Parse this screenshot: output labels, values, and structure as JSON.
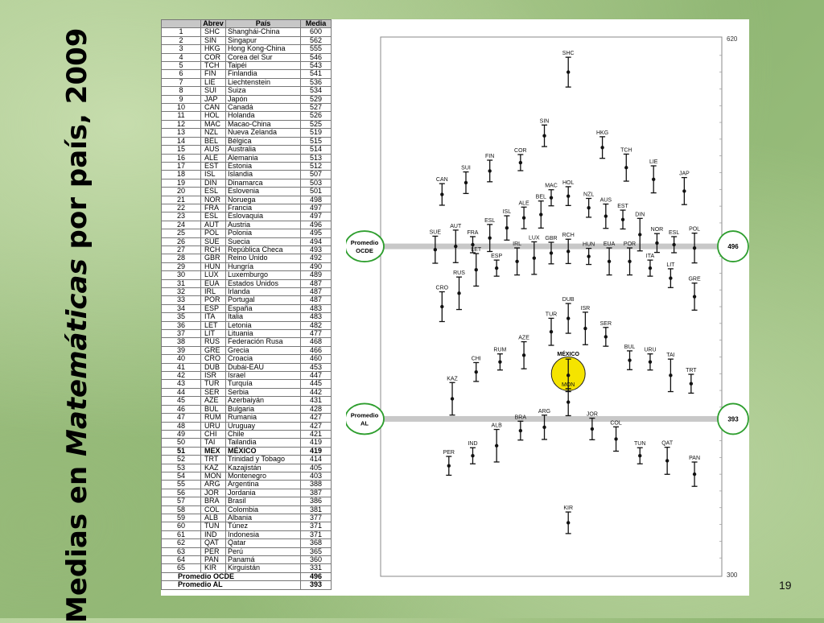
{
  "title": {
    "pre": "Medias en ",
    "italic": "Matemáticas",
    "post": " por país, 2009"
  },
  "page_number": "19",
  "table": {
    "headers": [
      "Abrev",
      "País",
      "Media"
    ],
    "rows": [
      [
        "1",
        "SHC",
        "Shanghái-China",
        "600"
      ],
      [
        "2",
        "SIN",
        "Singapur",
        "562"
      ],
      [
        "3",
        "HKG",
        " Hong Kong-China",
        "555"
      ],
      [
        "4",
        "COR",
        "Corea del Sur",
        "546"
      ],
      [
        "5",
        "TCH",
        "Taipéi",
        "543"
      ],
      [
        "6",
        "FIN",
        "Finlandia",
        "541"
      ],
      [
        "7",
        "LIE",
        "Liechtenstein",
        "536"
      ],
      [
        "8",
        "SUI",
        "Suiza",
        "534"
      ],
      [
        "9",
        "JAP",
        "Japón",
        "529"
      ],
      [
        "10",
        "CAN",
        "Canadá",
        "527"
      ],
      [
        "11",
        "HOL",
        "Holanda",
        "526"
      ],
      [
        "12",
        "MAC",
        "Macao-China",
        "525"
      ],
      [
        "13",
        "NZL",
        "Nueva Zelanda",
        "519"
      ],
      [
        "14",
        "BEL",
        "Bélgica",
        "515"
      ],
      [
        "15",
        "AUS",
        "Australia",
        "514"
      ],
      [
        "16",
        "ALE",
        "Alemania",
        "513"
      ],
      [
        "17",
        "EST",
        "Estonia",
        "512"
      ],
      [
        "18",
        "ISL",
        "Islandia",
        "507"
      ],
      [
        "19",
        "DIN",
        "Dinamarca",
        "503"
      ],
      [
        "20",
        "ESL",
        "Eslovenia",
        "501"
      ],
      [
        "21",
        "NOR",
        "Noruega",
        "498"
      ],
      [
        "22",
        "FRA",
        "Francia",
        "497"
      ],
      [
        "23",
        "ESL",
        "Eslovaquia",
        "497"
      ],
      [
        "24",
        "AUT",
        "Austria",
        "496"
      ],
      [
        "25",
        "POL",
        "Polonia",
        "495"
      ],
      [
        "26",
        "SUE",
        "Suecia",
        "494"
      ],
      [
        "27",
        "RCH",
        "República Checa",
        "493"
      ],
      [
        "28",
        "GBR",
        "Reino Unido",
        "492"
      ],
      [
        "29",
        "HUN",
        "Hungría",
        "490"
      ],
      [
        "30",
        "LUX",
        "Luxemburgo",
        "489"
      ],
      [
        "31",
        "EUA",
        "Estados Unidos",
        "487"
      ],
      [
        "32",
        "IRL",
        "Irlanda",
        "487"
      ],
      [
        "33",
        "POR",
        "Portugal",
        "487"
      ],
      [
        "34",
        "ESP",
        "España",
        "483"
      ],
      [
        "35",
        "ITA",
        "Italia",
        "483"
      ],
      [
        "36",
        "LET",
        "Letonia",
        "482"
      ],
      [
        "37",
        "LIT",
        "Lituania",
        "477"
      ],
      [
        "38",
        "RUS",
        "Federación Rusa",
        "468"
      ],
      [
        "39",
        "GRE",
        "Grecia",
        "466"
      ],
      [
        "40",
        "CRO",
        "Croacia",
        "460"
      ],
      [
        "41",
        "DUB",
        "Dubái-EAU",
        "453"
      ],
      [
        "42",
        "ISR",
        "Israel",
        "447"
      ],
      [
        "43",
        "TUR",
        "Turquía",
        "445"
      ],
      [
        "44",
        "SER",
        "Serbia",
        "442"
      ],
      [
        "45",
        "AZE",
        "Azerbaiyán",
        "431"
      ],
      [
        "46",
        "BUL",
        "Bulgaria",
        "428"
      ],
      [
        "47",
        "RUM",
        "Rumania",
        "427"
      ],
      [
        "48",
        "URU",
        "Uruguay",
        "427"
      ],
      [
        "49",
        "CHI",
        "Chile",
        "421"
      ],
      [
        "50",
        "TAI",
        "Tailandia",
        "419"
      ],
      [
        "51",
        "MEX",
        "MÉXICO",
        "419"
      ],
      [
        "52",
        "TRT",
        "Trinidad y Tobago",
        "414"
      ],
      [
        "53",
        "KAZ",
        "Kazajistán",
        "405"
      ],
      [
        "54",
        "MON",
        "Montenegro",
        "403"
      ],
      [
        "55",
        "ARG",
        "Argentina",
        "388"
      ],
      [
        "56",
        "JOR",
        "Jordania",
        "387"
      ],
      [
        "57",
        "BRA",
        "Brasil",
        "386"
      ],
      [
        "58",
        "COL",
        "Colombia",
        "381"
      ],
      [
        "59",
        "ALB",
        "Albania",
        "377"
      ],
      [
        "60",
        "TUN",
        "Túnez",
        "371"
      ],
      [
        "61",
        "IND",
        "Indonesia",
        "371"
      ],
      [
        "62",
        "QAT",
        "Qatar",
        "368"
      ],
      [
        "63",
        "PER",
        "Perú",
        "365"
      ],
      [
        "64",
        "PAN",
        "Panamá",
        "360"
      ],
      [
        "65",
        "KIR",
        "Kirguistán",
        "331"
      ]
    ],
    "summary": [
      [
        "Promedio OCDE",
        "496"
      ],
      [
        "Promedio AL",
        "393"
      ]
    ]
  },
  "chart_data": {
    "type": "scatter",
    "ylim": [
      300,
      620
    ],
    "y_ticks": [
      "620",
      "300"
    ],
    "reference_lines": [
      {
        "label_line1": "Promedio",
        "label_line2": "OCDE",
        "value": 496,
        "value_label": "496"
      },
      {
        "label_line1": "Promedio",
        "label_line2": "AL",
        "value": 393,
        "value_label": "393"
      }
    ],
    "highlight": {
      "code": "MEX",
      "label": "MÉXICO",
      "color": "#f5e400"
    },
    "countries": [
      {
        "code": "SHC",
        "value": 600,
        "col": 0.55
      },
      {
        "code": "SIN",
        "value": 562,
        "col": 0.48
      },
      {
        "code": "HKG",
        "value": 555,
        "col": 0.65
      },
      {
        "code": "COR",
        "value": 546,
        "col": 0.41
      },
      {
        "code": "TCH",
        "value": 543,
        "col": 0.72
      },
      {
        "code": "FIN",
        "value": 541,
        "col": 0.32
      },
      {
        "code": "LIE",
        "value": 536,
        "col": 0.8
      },
      {
        "code": "SUI",
        "value": 534,
        "col": 0.25
      },
      {
        "code": "JAP",
        "value": 529,
        "col": 0.89
      },
      {
        "code": "CAN",
        "value": 527,
        "col": 0.18
      },
      {
        "code": "HOL",
        "value": 526,
        "col": 0.55
      },
      {
        "code": "MAC",
        "value": 525,
        "col": 0.5
      },
      {
        "code": "NZL",
        "value": 519,
        "col": 0.61
      },
      {
        "code": "BEL",
        "value": 515,
        "col": 0.47
      },
      {
        "code": "AUS",
        "value": 514,
        "col": 0.66
      },
      {
        "code": "ALE",
        "value": 513,
        "col": 0.42
      },
      {
        "code": "EST",
        "value": 512,
        "col": 0.71
      },
      {
        "code": "ISL",
        "value": 507,
        "col": 0.37
      },
      {
        "code": "DIN",
        "value": 503,
        "col": 0.76
      },
      {
        "code": "ESL",
        "value": 501,
        "col": 0.32
      },
      {
        "code": "NOR",
        "value": 498,
        "col": 0.81
      },
      {
        "code": "FRA",
        "value": 497,
        "col": 0.27
      },
      {
        "code": "ESL",
        "value": 497,
        "col": 0.86
      },
      {
        "code": "AUT",
        "value": 496,
        "col": 0.22
      },
      {
        "code": "POL",
        "value": 495,
        "col": 0.92
      },
      {
        "code": "SUE",
        "value": 494,
        "col": 0.16
      },
      {
        "code": "RCH",
        "value": 493,
        "col": 0.55
      },
      {
        "code": "GBR",
        "value": 492,
        "col": 0.5
      },
      {
        "code": "HUN",
        "value": 490,
        "col": 0.61
      },
      {
        "code": "LUX",
        "value": 489,
        "col": 0.45
      },
      {
        "code": "EUA",
        "value": 487,
        "col": 0.67
      },
      {
        "code": "IRL",
        "value": 487,
        "col": 0.4
      },
      {
        "code": "POR",
        "value": 487,
        "col": 0.73
      },
      {
        "code": "ESP",
        "value": 483,
        "col": 0.34
      },
      {
        "code": "ITA",
        "value": 483,
        "col": 0.79
      },
      {
        "code": "LET",
        "value": 482,
        "col": 0.28
      },
      {
        "code": "LIT",
        "value": 477,
        "col": 0.85
      },
      {
        "code": "RUS",
        "value": 468,
        "col": 0.23
      },
      {
        "code": "GRE",
        "value": 466,
        "col": 0.92
      },
      {
        "code": "CRO",
        "value": 460,
        "col": 0.18
      },
      {
        "code": "DUB",
        "value": 453,
        "col": 0.55
      },
      {
        "code": "ISR",
        "value": 447,
        "col": 0.6
      },
      {
        "code": "TUR",
        "value": 445,
        "col": 0.5
      },
      {
        "code": "SER",
        "value": 442,
        "col": 0.66
      },
      {
        "code": "AZE",
        "value": 431,
        "col": 0.42
      },
      {
        "code": "BUL",
        "value": 428,
        "col": 0.73
      },
      {
        "code": "RUM",
        "value": 427,
        "col": 0.35
      },
      {
        "code": "URU",
        "value": 427,
        "col": 0.79
      },
      {
        "code": "CHI",
        "value": 421,
        "col": 0.28
      },
      {
        "code": "TAI",
        "value": 419,
        "col": 0.85
      },
      {
        "code": "MEX",
        "value": 419,
        "col": 0.55
      },
      {
        "code": "TRT",
        "value": 414,
        "col": 0.91
      },
      {
        "code": "KAZ",
        "value": 405,
        "col": 0.21
      },
      {
        "code": "MON",
        "value": 403,
        "col": 0.55
      },
      {
        "code": "ARG",
        "value": 388,
        "col": 0.48
      },
      {
        "code": "JOR",
        "value": 387,
        "col": 0.62
      },
      {
        "code": "BRA",
        "value": 386,
        "col": 0.41
      },
      {
        "code": "COL",
        "value": 381,
        "col": 0.69
      },
      {
        "code": "ALB",
        "value": 377,
        "col": 0.34
      },
      {
        "code": "TUN",
        "value": 371,
        "col": 0.76
      },
      {
        "code": "IND",
        "value": 371,
        "col": 0.27
      },
      {
        "code": "QAT",
        "value": 368,
        "col": 0.84
      },
      {
        "code": "PER",
        "value": 365,
        "col": 0.2
      },
      {
        "code": "PAN",
        "value": 360,
        "col": 0.92
      },
      {
        "code": "KIR",
        "value": 331,
        "col": 0.55
      }
    ]
  }
}
